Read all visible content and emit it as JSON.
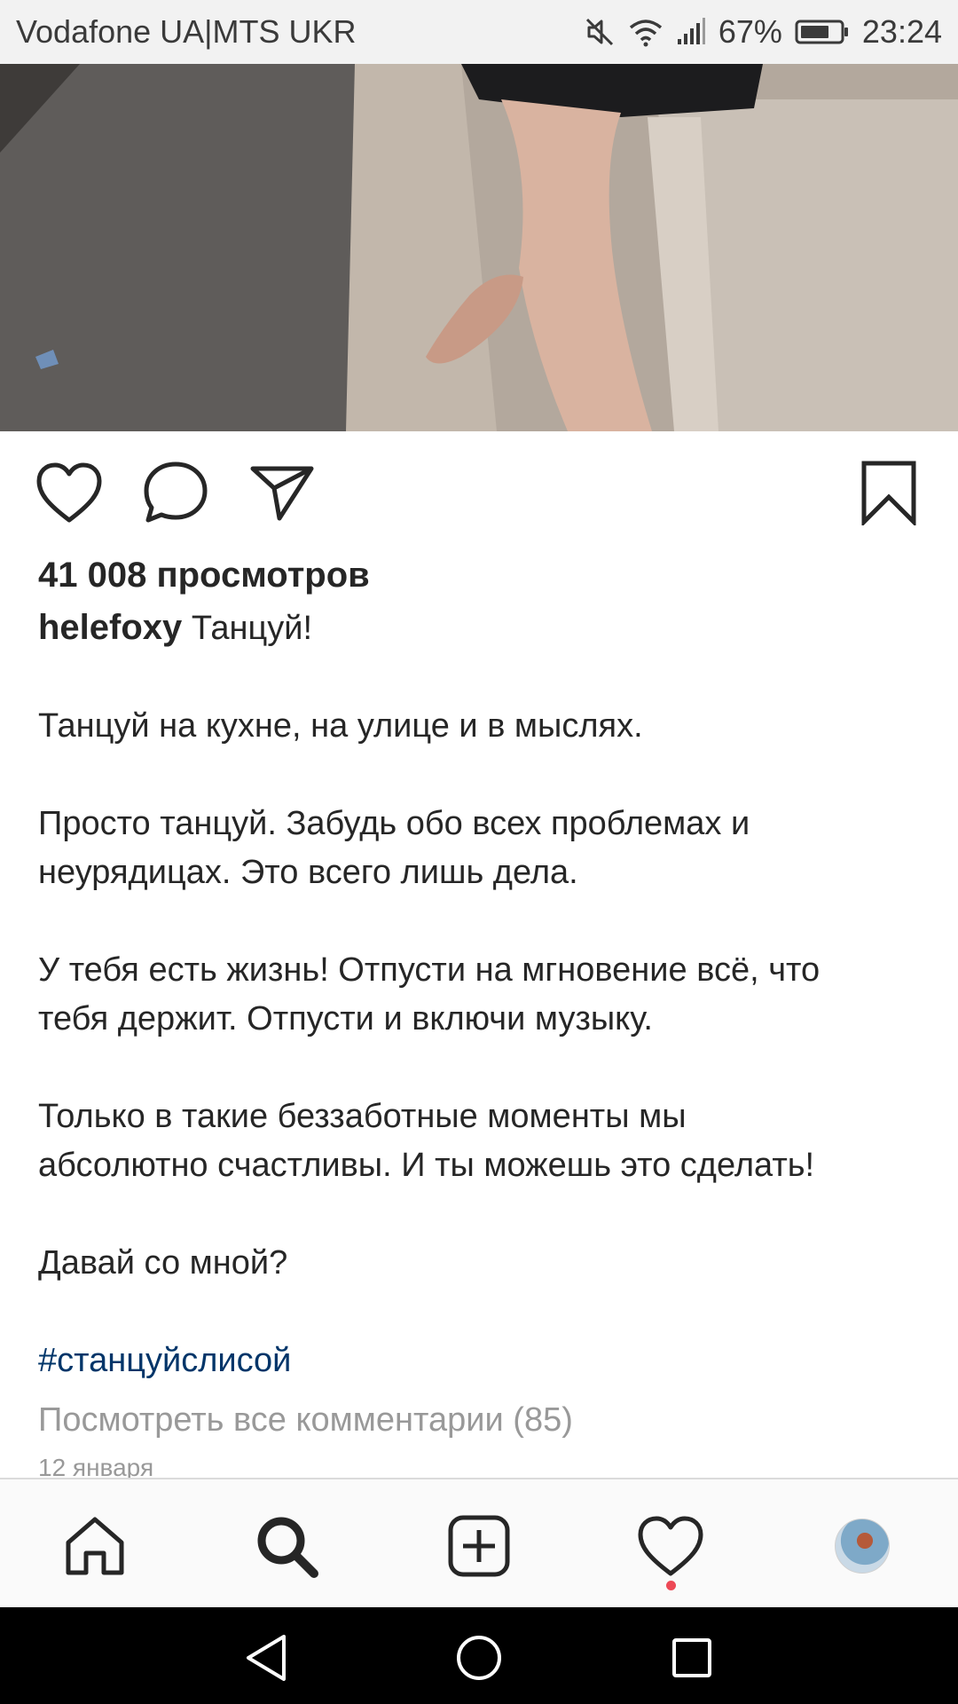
{
  "status_bar": {
    "carrier": "Vodafone UA|MTS UKR",
    "battery": "67%",
    "time": "23:24"
  },
  "post": {
    "views": "41 008 просмотров",
    "username": "helefoxy",
    "caption_title": "Танцуй!",
    "paragraphs": [
      [
        "Танцуй на кухне, на улице и в мыслях."
      ],
      [
        "Просто танцуй. Забудь обо всех проблемах и",
        "неурядицах. Это всего лишь дела."
      ],
      [
        "У тебя есть жизнь! Отпусти на мгновение всё, что",
        "тебя держит. Отпусти и включи музыку."
      ],
      [
        "Только в такие беззаботные моменты мы",
        "абсолютно счастливы. И ты можешь это сделать!"
      ],
      [
        "Давай со мной?"
      ]
    ],
    "hashtag": "#станцуйслисой",
    "view_comments": "Посмотреть все комментарии (85)",
    "date": "12 января"
  },
  "icons": {
    "action_row": [
      "heart-icon",
      "comment-icon",
      "share-icon",
      "bookmark-icon"
    ],
    "bottom_nav": [
      "home-icon",
      "search-icon",
      "add-post-icon",
      "activity-heart-icon",
      "profile-avatar"
    ],
    "system_nav": [
      "back-icon",
      "home-circle-icon",
      "recents-icon"
    ]
  },
  "colors": {
    "hashtag": "#003569",
    "secondary_text": "#999999",
    "notification_dot": "#ed4956"
  }
}
